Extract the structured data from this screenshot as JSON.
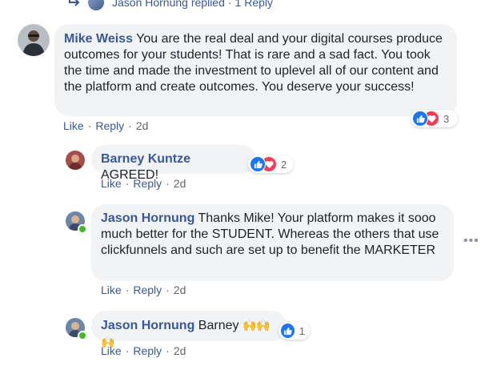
{
  "top_reply": {
    "author": "Jason Hornung",
    "verb": "replied",
    "count_label": "1 Reply"
  },
  "comments": [
    {
      "author": "Mike Weiss",
      "text": "You are the real deal and your digital courses produce outcomes for your students! That is rare and a sad fact. You took the time and made the investment to uplevel all of our content and the platform and create outcomes. You deserve your success!",
      "like_label": "Like",
      "reply_label": "Reply",
      "time": "2d",
      "reaction_count": "3"
    }
  ],
  "replies": [
    {
      "author": "Barney Kuntze",
      "text": "AGREED!",
      "like_label": "Like",
      "reply_label": "Reply",
      "time": "2d",
      "reaction_count": "2"
    },
    {
      "author": "Jason Hornung",
      "text": "Thanks Mike! Your platform makes it sooo much better for the STUDENT. Whereas the others that use clickfunnels and such are set up to benefit the MARKETER",
      "like_label": "Like",
      "reply_label": "Reply",
      "time": "2d"
    },
    {
      "author": "Jason Hornung",
      "text": "Barney",
      "emoji": "🙌🙌🙌",
      "like_label": "Like",
      "reply_label": "Reply",
      "time": "2d",
      "reaction_count": "1"
    }
  ],
  "more_options": "•••",
  "separator": "·",
  "colors": {
    "link": "#385898",
    "bubble": "#f2f3f5",
    "like": "#1877f2",
    "love": "#f33e58",
    "online": "#42b72a"
  }
}
